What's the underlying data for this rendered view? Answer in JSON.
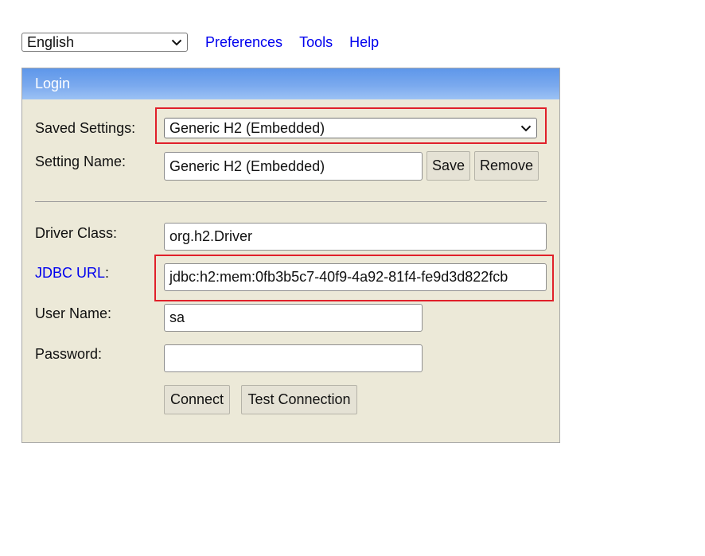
{
  "topbar": {
    "language": "English",
    "links": [
      "Preferences",
      "Tools",
      "Help"
    ]
  },
  "login": {
    "title": "Login",
    "saved_settings_label": "Saved Settings:",
    "saved_settings_value": "Generic H2 (Embedded)",
    "setting_name_label": "Setting Name:",
    "setting_name_value": "Generic H2 (Embedded)",
    "save_label": "Save",
    "remove_label": "Remove",
    "driver_class_label": "Driver Class:",
    "driver_class_value": "org.h2.Driver",
    "jdbc_url_label": "JDBC URL",
    "jdbc_url_colon": ":",
    "jdbc_url_value": "jdbc:h2:mem:0fb3b5c7-40f9-4a92-81f4-fe9d3d822fcb",
    "user_name_label": "User Name:",
    "user_name_value": "sa",
    "password_label": "Password:",
    "password_value": "",
    "connect_label": "Connect",
    "test_connection_label": "Test Connection"
  },
  "colors": {
    "header_blue": "#6a9eec",
    "panel_bg": "#ece9d8",
    "link": "#0000ee",
    "highlight_red": "#e0202a"
  },
  "icons": {
    "dropdown": "chevron-down-icon"
  }
}
